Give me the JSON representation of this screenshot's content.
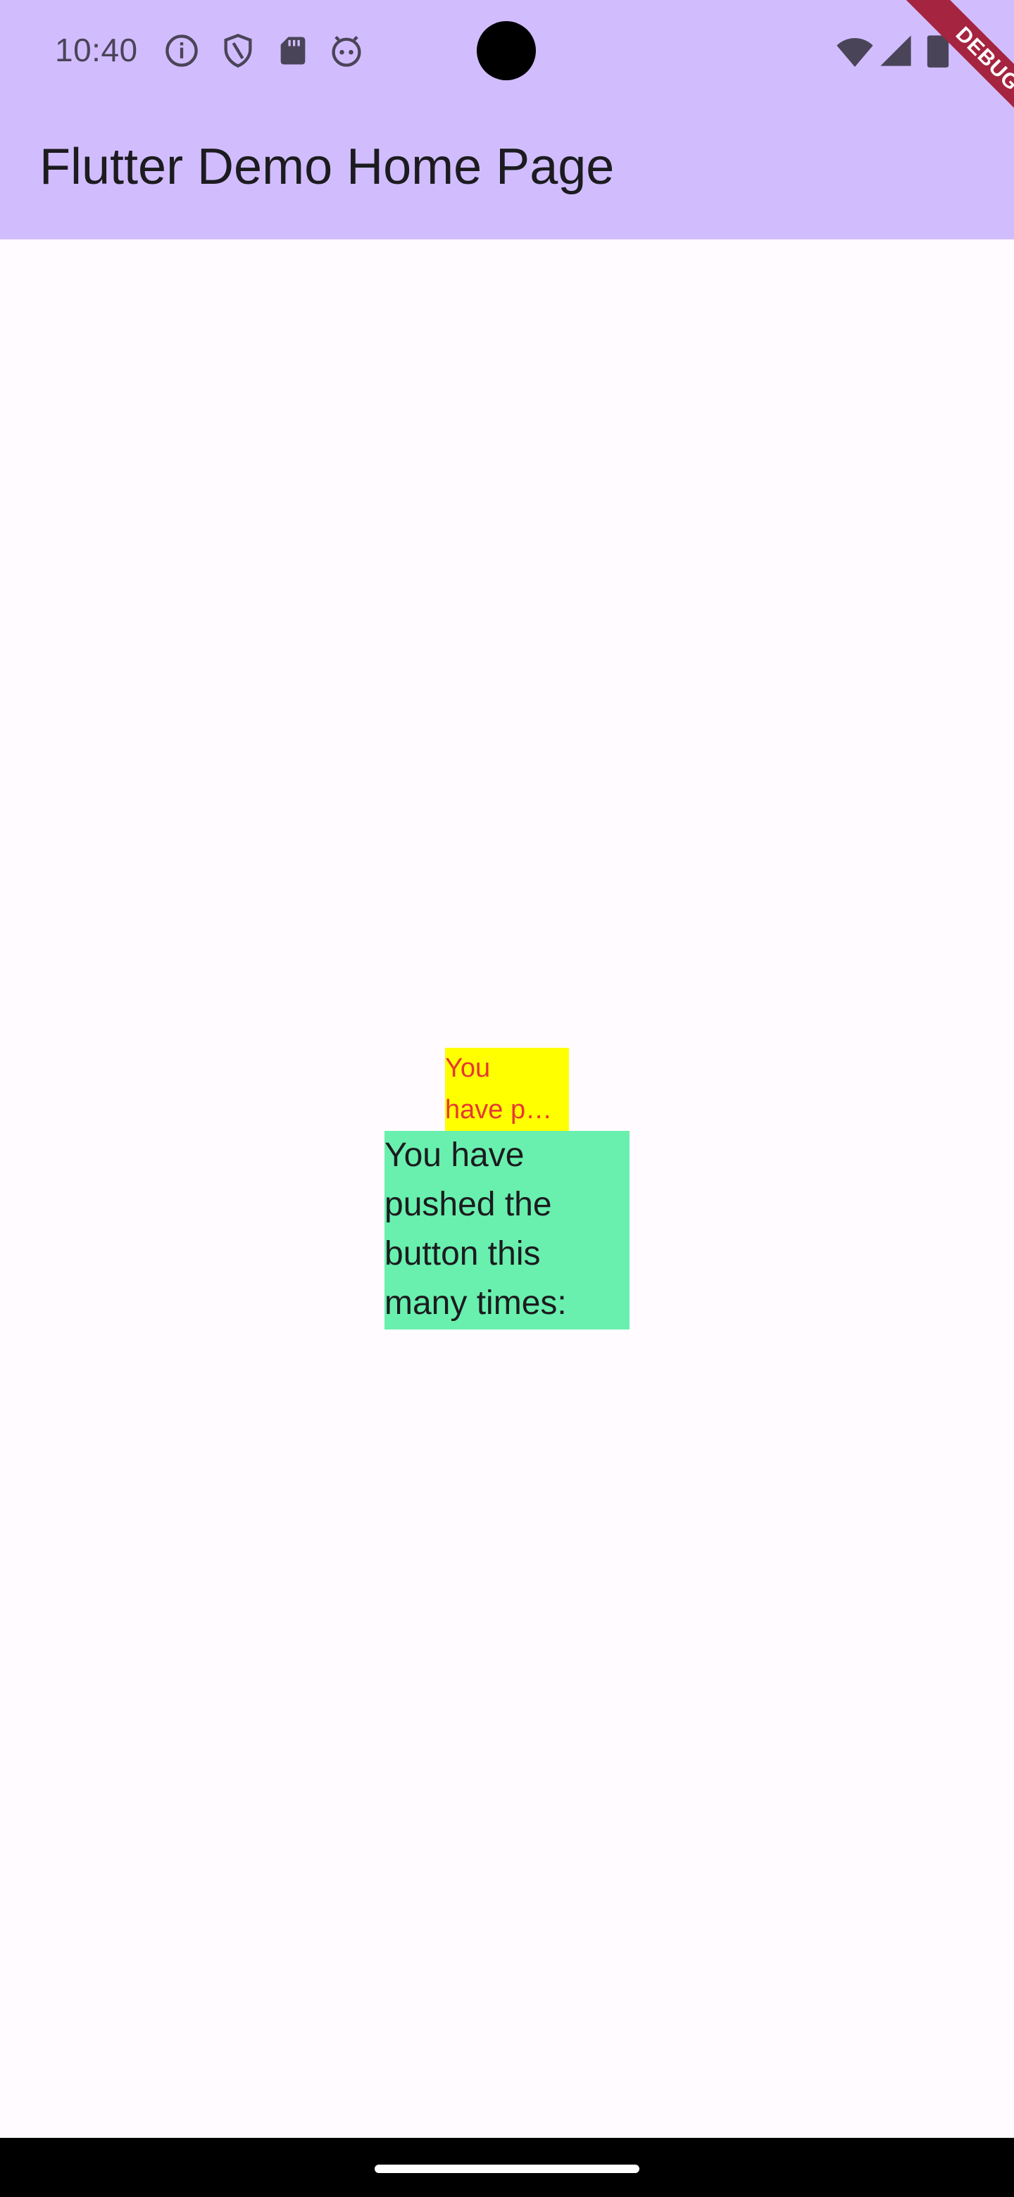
{
  "status_bar": {
    "time": "10:40",
    "left_icons": [
      "info-icon",
      "shield-icon",
      "sd-card-icon",
      "android-face-icon"
    ],
    "right_icons": [
      "wifi-icon",
      "cell-signal-icon",
      "battery-icon"
    ],
    "background": "#d1bdfe"
  },
  "app_bar": {
    "title": "Flutter Demo Home Page",
    "background": "#d1bdfe"
  },
  "debug_banner": {
    "label": "DEBUG",
    "color": "#a5243f"
  },
  "main": {
    "small_text": {
      "lines": [
        "You",
        "have p…"
      ],
      "background": "#ffff00",
      "text_color": "#e53935"
    },
    "counter_label": {
      "lines": [
        "You have",
        "pushed the",
        "button this",
        "many times:"
      ],
      "background": "#69f0ae"
    }
  },
  "nav_bar": {
    "background": "#000000"
  }
}
